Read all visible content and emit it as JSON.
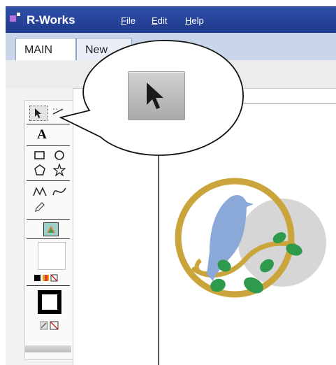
{
  "app": {
    "title": "R-Works"
  },
  "menu": {
    "file": {
      "mnemonic": "F",
      "rest": "ile"
    },
    "edit": {
      "mnemonic": "E",
      "rest": "dit"
    },
    "help": {
      "mnemonic": "H",
      "rest": "elp"
    }
  },
  "tabs": [
    {
      "label": "MAIN"
    },
    {
      "label": "New"
    }
  ],
  "tools": {
    "text_tool_label": "A"
  },
  "colors": {
    "titlebar": "#2f4fa8",
    "logo_gold": "#c9a53c",
    "bird_blue": "#8aa9d8",
    "leaf_green": "#2e9a4c",
    "moon_gray": "#d6d6d6"
  },
  "icons": {
    "selection_arrow": "pointer-arrow-icon",
    "callout_arrow": "pointer-arrow-icon"
  }
}
